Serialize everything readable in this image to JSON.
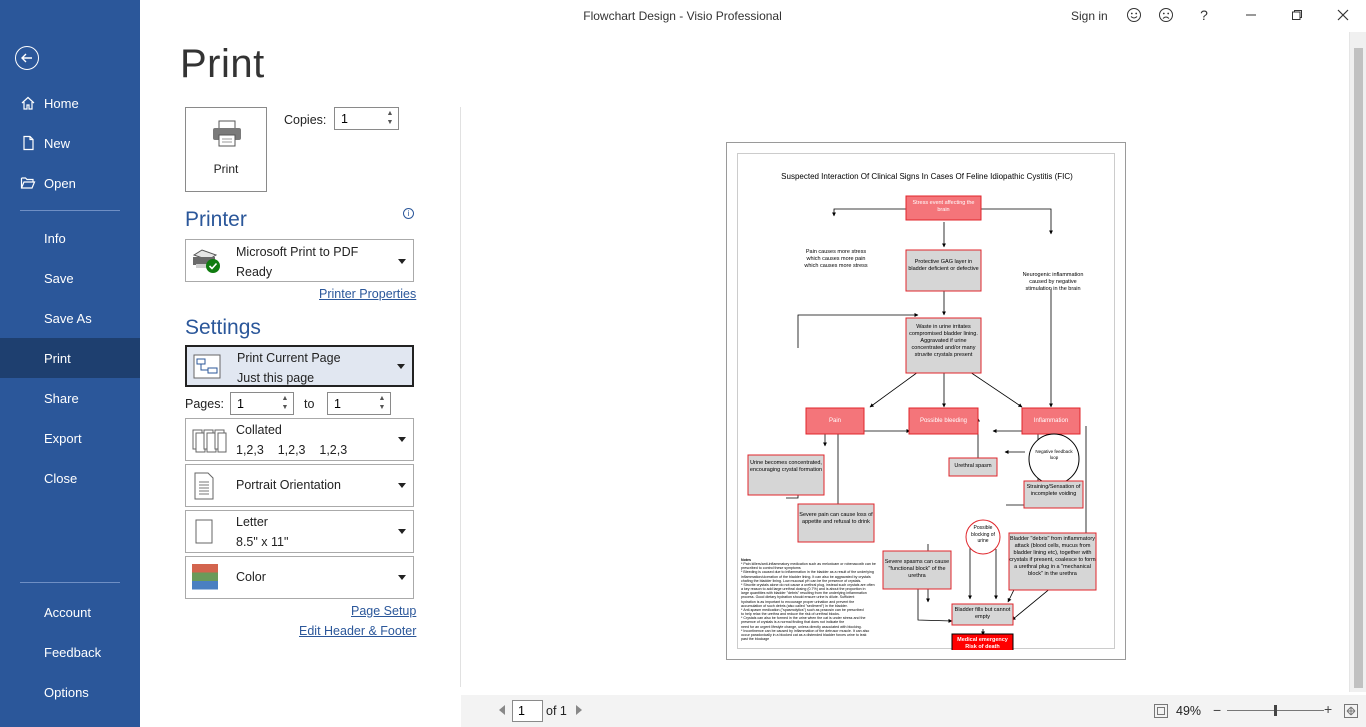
{
  "window": {
    "title": "Flowchart Design  -  Visio Professional",
    "signin": "Sign in",
    "help": "?"
  },
  "nav": {
    "items": [
      {
        "label": "Home"
      },
      {
        "label": "New"
      },
      {
        "label": "Open"
      },
      {
        "label": "Info"
      },
      {
        "label": "Save"
      },
      {
        "label": "Save As"
      },
      {
        "label": "Print"
      },
      {
        "label": "Share"
      },
      {
        "label": "Export"
      },
      {
        "label": "Close"
      },
      {
        "label": "Account"
      },
      {
        "label": "Feedback"
      },
      {
        "label": "Options"
      }
    ],
    "active": "Print",
    "colors": {
      "bg": "#2b579a",
      "active_bg": "#1e3f6f"
    }
  },
  "print": {
    "heading": "Print",
    "print_button": "Print",
    "copies_label": "Copies:",
    "copies_value": "1"
  },
  "printer": {
    "section": "Printer",
    "name": "Microsoft Print to PDF",
    "status": "Ready",
    "properties_link": "Printer Properties"
  },
  "settings": {
    "section": "Settings",
    "scope": {
      "title": "Print Current Page",
      "subtitle": "Just this page"
    },
    "pages_label": "Pages:",
    "pages_from": "1",
    "to_label": "to",
    "pages_to": "1",
    "collation": {
      "title": "Collated",
      "subtitle": "1,2,3    1,2,3    1,2,3"
    },
    "orientation": {
      "title": "Portrait Orientation"
    },
    "paper": {
      "title": "Letter",
      "subtitle": "8.5\" x 11\""
    },
    "color": {
      "title": "Color"
    },
    "page_setup_link": "Page Setup",
    "header_footer_link": "Edit Header & Footer"
  },
  "preview": {
    "diagram_title": "Suspected Interaction Of Clinical Signs In Cases Of Feline Idiopathic Cystitis (FIC)",
    "nodes": {
      "stress": "Stress event affecting the brain",
      "pain_stress": "Pain causes more stress which causes more pain which causes more stress",
      "gag": "Protective GAG layer in bladder deficient or defective",
      "neuro": "Neurogenic inflammation caused by negative stimulation in the brain",
      "waste": "Waste in urine irritates compromised bladder lining. Aggravated if urine concentrated and/or many struvite crystals present",
      "pain": "Pain",
      "bleeding": "Possible bleeding",
      "inflammation": "Inflammation",
      "urine_conc": "Urine becomes concentrated, encouraging crystal formation",
      "feedback": "Negative feedback loop",
      "spasm": "Urethral spasm",
      "straining": "Straining/Sensation of incomplete voiding",
      "severe_pain": "Severe pain can cause loss of appetite and refusal to drink",
      "blocking": "Possible blocking of urine",
      "debris": "Bladder \"debris\" from inflammatory attack (blood cells, mucus from bladder lining etc), together with crystals if present, coalesce to form a urethral plug in a \"mechanical block\" in the urethra",
      "severe_spasm": "Severe spasms can cause \"functional block\" of the urethra",
      "fills": "Bladder fills but cannot empty",
      "emergency": "Medical emergency Risk of death"
    },
    "notes_title": "Notes",
    "notes_lines": [
      "* Pain killers/anti-inflammatory medication such as meloxicam or robenacoxib can be",
      "prescribed to control these symptoms",
      "* Bleeding is caused due to inflammation in the bladder as a result of the underlying",
      "inflammation/ulceration of the bladder lining. It can also be aggravated by crystals",
      "chafing the bladder lining. Low mucosal pH can be the presence of crystals.",
      "* Struvite crystals alone do not cause a urethral plug, instead such crystals are often",
      "a key reason to add large urethral dosing (0.7%) and is about the proportion in",
      "large quantities with bladder \"debris\" resulting from the underlying inflammation",
      "process. Good dietary hydration should ensure urine is dilute. Sufficient",
      "hydration is as important to encourage proper urination and prevent the",
      "accumulation of such debris (also called \"sediment\") in the bladder.",
      "* Anti-spasm medication (\"spasmolytics\") such as prazosin can be prescribed",
      "to help relax the urethra and reduce the risk of urethral blocks.",
      "* Crystals can also be formed in the urine when the cat is under stress and the",
      "presence of crystals is a normal finding that does not indicate the",
      "need for an urgent lifestyle change, unless directly associated with blocking.",
      "* Incontinence can be caused by inflammation of the detrusor muscle. It can also",
      "occur paradoxically in a blocked cat as a distended bladder forces urine to leak",
      "past the blockage"
    ],
    "colors": {
      "red_box": "#f4757a",
      "red_border": "#e0252b",
      "gray_box": "#d6d6d6",
      "emergency": "#ff0000"
    }
  },
  "pager": {
    "current": "1",
    "of_label": "of 1"
  },
  "zoom": {
    "percent": "49%",
    "level": 0.49
  }
}
